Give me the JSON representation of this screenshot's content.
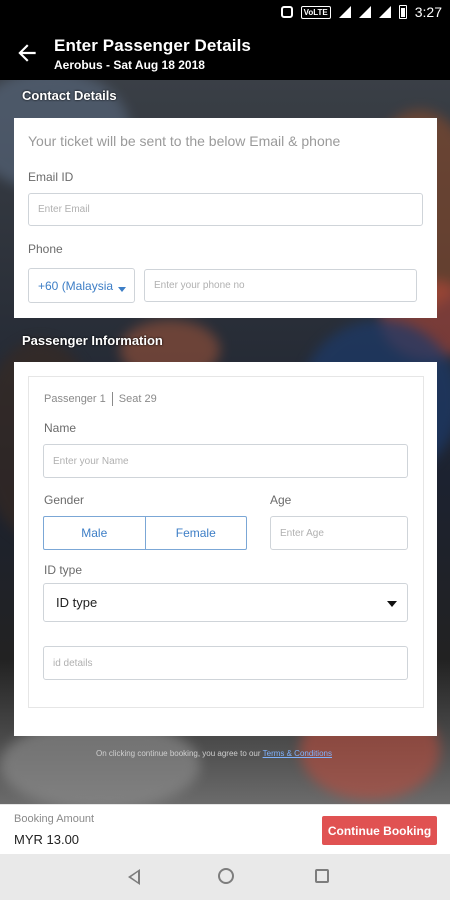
{
  "status_bar": {
    "time": "3:27",
    "network": "VoLTE"
  },
  "header": {
    "title": "Enter Passenger Details",
    "subtitle": "Aerobus - Sat Aug 18 2018"
  },
  "contact": {
    "section_label": "Contact Details",
    "hint": "Your ticket will be sent to the below Email & phone",
    "email_label": "Email ID",
    "email_placeholder": "Enter Email",
    "phone_label": "Phone",
    "country_code": "+60 (Malaysia",
    "phone_placeholder": "Enter your phone no"
  },
  "passenger": {
    "section_label": "Passenger Information",
    "passenger_no": "Passenger 1",
    "seat": "Seat 29",
    "name_label": "Name",
    "name_placeholder": "Enter your Name",
    "gender_label": "Gender",
    "gender_options": [
      "Male",
      "Female"
    ],
    "age_label": "Age",
    "age_placeholder": "Enter Age",
    "id_type_label": "ID type",
    "id_type_value": "ID type",
    "id_details_placeholder": "id details"
  },
  "terms": {
    "text": "On clicking continue booking, you agree to our",
    "link": "Terms & Conditions"
  },
  "booking": {
    "amount_label": "Booking Amount",
    "amount_value": "MYR 13.00",
    "continue_label": "Continue Booking"
  },
  "colors": {
    "accent": "#3d7ec6",
    "cta": "#e05252"
  }
}
